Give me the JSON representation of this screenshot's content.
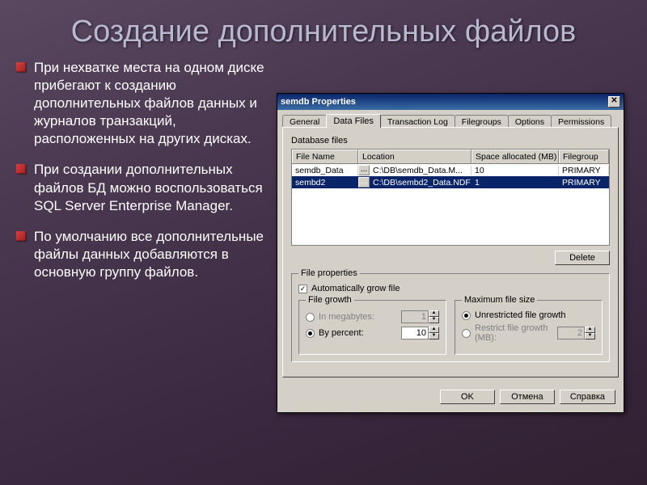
{
  "slide": {
    "title": "Создание дополнительных файлов",
    "bullets": [
      "При нехватке места на одном диске прибегают к созданию дополнительных файлов данных и журналов транзакций, расположенных на других дисках.",
      "При создании дополнительных файлов БД можно воспользоваться SQL Server Enterprise Manager.",
      "По умолчанию все дополнительные файлы данных добавляются в основную группу файлов."
    ]
  },
  "dialog": {
    "title": "semdb Properties",
    "tabs": [
      "General",
      "Data Files",
      "Transaction Log",
      "Filegroups",
      "Options",
      "Permissions"
    ],
    "active_tab": 1,
    "db_files_label": "Database files",
    "columns": [
      "File Name",
      "Location",
      "Space allocated (MB)",
      "Filegroup"
    ],
    "rows": [
      {
        "name": "semdb_Data",
        "loc": "C:\\DB\\semdb_Data.M...",
        "space": "10",
        "fg": "PRIMARY",
        "selected": false
      },
      {
        "name": "sembd2",
        "loc": "C:\\DB\\sembd2_Data.NDF",
        "space": "1",
        "fg": "PRIMARY",
        "selected": true
      }
    ],
    "delete": "Delete",
    "file_props": "File properties",
    "auto_grow": "Automatically grow file",
    "file_growth": "File growth",
    "in_mb": "In megabytes:",
    "by_pct": "By percent:",
    "by_pct_val": "10",
    "in_mb_val": "1",
    "max_size": "Maximum file size",
    "unrestricted": "Unrestricted file growth",
    "restrict": "Restrict file growth (MB):",
    "restrict_val": "2",
    "ok": "OK",
    "cancel": "Отмена",
    "help": "Справка"
  }
}
